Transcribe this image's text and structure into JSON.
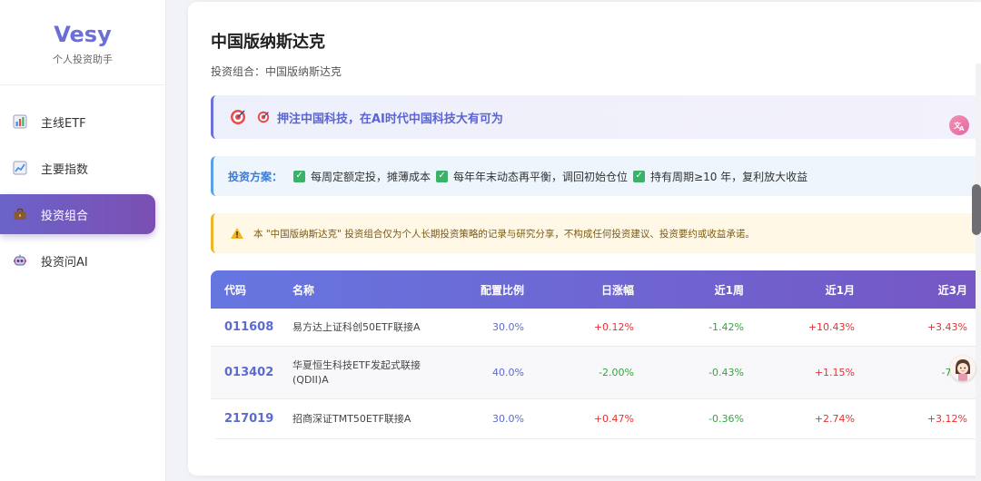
{
  "brand": {
    "name": "Vesy",
    "subtitle": "个人投资助手"
  },
  "nav": [
    {
      "label": "主线ETF",
      "icon": "bar-chart-icon",
      "active": false
    },
    {
      "label": "主要指数",
      "icon": "line-chart-icon",
      "active": false
    },
    {
      "label": "投资组合",
      "icon": "briefcase-icon",
      "active": true
    },
    {
      "label": "投资问AI",
      "icon": "robot-icon",
      "active": false
    }
  ],
  "page": {
    "title": "中国版纳斯达克",
    "subtitle": "投资组合：中国版纳斯达克",
    "slogan": "押注中国科技，在AI时代中国科技大有可为",
    "plan_label": "投资方案：",
    "plan_items": [
      "每周定额定投，摊薄成本",
      "每年年末动态再平衡，调回初始仓位",
      "持有周期≥10 年，复利放大收益"
    ],
    "warning": "本 \"中国版纳斯达克\" 投资组合仅为个人长期投资策略的记录与研究分享，不构成任何投资建议、投资要约或收益承诺。"
  },
  "table": {
    "headers": [
      "代码",
      "名称",
      "配置比例",
      "日涨幅",
      "近1周",
      "近1月",
      "近3月"
    ],
    "rows": [
      {
        "code": "011608",
        "name": "易方达上证科创50ETF联接A",
        "ratio": "30.0%",
        "day": "+0.12%",
        "week": "-1.42%",
        "month": "+10.43%",
        "m3": "+3.43%"
      },
      {
        "code": "013402",
        "name": "华夏恒生科技ETF发起式联接(QDII)A",
        "name_line1": "华夏恒生科技ETF发起式联接",
        "name_line2": "(QDII)A",
        "ratio": "40.0%",
        "day": "-2.00%",
        "week": "-0.43%",
        "month": "+1.15%",
        "m3": "-7.22"
      },
      {
        "code": "217019",
        "name": "招商深证TMT50ETF联接A",
        "ratio": "30.0%",
        "day": "+0.47%",
        "week": "-0.36%",
        "month": "+2.74%",
        "m3": "+3.12%"
      }
    ]
  },
  "colors": {
    "accent": "#6b6fd4",
    "positive": "#e8302f",
    "negative": "#2fa83a",
    "warning_bg": "#fff8e6"
  }
}
